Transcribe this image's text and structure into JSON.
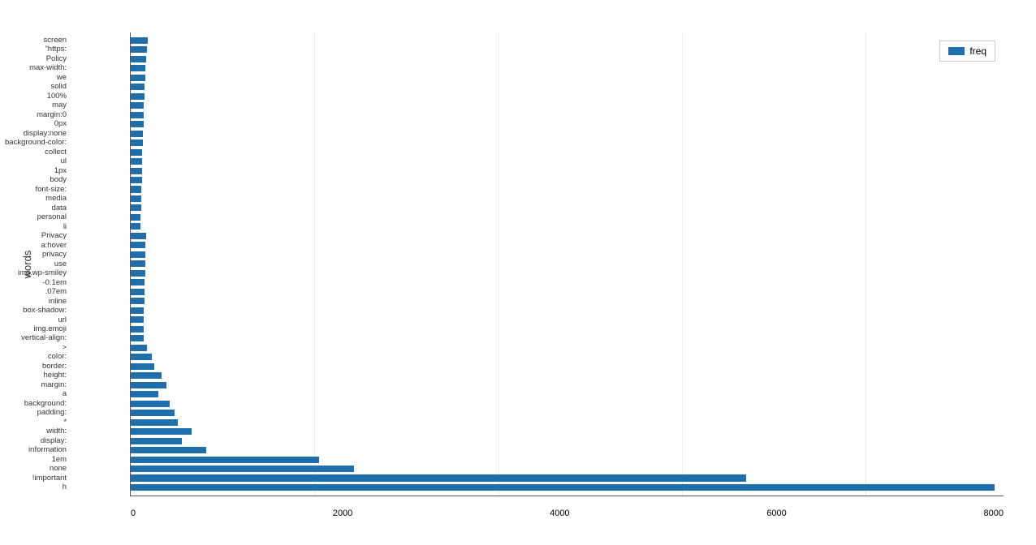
{
  "chart": {
    "title": "words",
    "legend_label": "freq",
    "x_axis_ticks": [
      "0",
      "2000",
      "4000",
      "6000",
      "8000"
    ],
    "max_value": 9500,
    "bars": [
      {
        "label": "screen",
        "value": 185
      },
      {
        "label": "\"https:",
        "value": 175
      },
      {
        "label": "Policy",
        "value": 168
      },
      {
        "label": "max-width:",
        "value": 162
      },
      {
        "label": "we",
        "value": 157
      },
      {
        "label": "solid",
        "value": 152
      },
      {
        "label": "100%",
        "value": 148
      },
      {
        "label": "may",
        "value": 144
      },
      {
        "label": "margin:0",
        "value": 140
      },
      {
        "label": "0px",
        "value": 138
      },
      {
        "label": "display:none",
        "value": 135
      },
      {
        "label": "background-color:",
        "value": 131
      },
      {
        "label": "collect",
        "value": 128
      },
      {
        "label": "ul",
        "value": 125
      },
      {
        "label": "1px",
        "value": 122
      },
      {
        "label": "body",
        "value": 120
      },
      {
        "label": "font-size:",
        "value": 117
      },
      {
        "label": "media",
        "value": 115
      },
      {
        "label": "data",
        "value": 112
      },
      {
        "label": "personal",
        "value": 110
      },
      {
        "label": "li",
        "value": 108
      },
      {
        "label": "Privacy",
        "value": 165
      },
      {
        "label": "a:hover",
        "value": 163
      },
      {
        "label": "privacy",
        "value": 160
      },
      {
        "label": "use",
        "value": 158
      },
      {
        "label": "img.wp-smiley",
        "value": 156
      },
      {
        "label": "-0.1em",
        "value": 153
      },
      {
        "label": ".07em",
        "value": 150
      },
      {
        "label": "inline",
        "value": 147
      },
      {
        "label": "box-shadow:",
        "value": 145
      },
      {
        "label": "url",
        "value": 143
      },
      {
        "label": "img.emoji",
        "value": 141
      },
      {
        "label": "vertical-align:",
        "value": 139
      },
      {
        "label": ">",
        "value": 180
      },
      {
        "label": "color:",
        "value": 230
      },
      {
        "label": "border:",
        "value": 260
      },
      {
        "label": "height:",
        "value": 340
      },
      {
        "label": "margin:",
        "value": 390
      },
      {
        "label": "a",
        "value": 300
      },
      {
        "label": "background:",
        "value": 420
      },
      {
        "label": "padding:",
        "value": 480
      },
      {
        "label": "*",
        "value": 510
      },
      {
        "label": "width:",
        "value": 660
      },
      {
        "label": "display:",
        "value": 560
      },
      {
        "label": "information",
        "value": 820
      },
      {
        "label": "1em",
        "value": 2050
      },
      {
        "label": "none",
        "value": 2430
      },
      {
        "label": "!important",
        "value": 6700
      },
      {
        "label": "h",
        "value": 9400
      }
    ]
  }
}
